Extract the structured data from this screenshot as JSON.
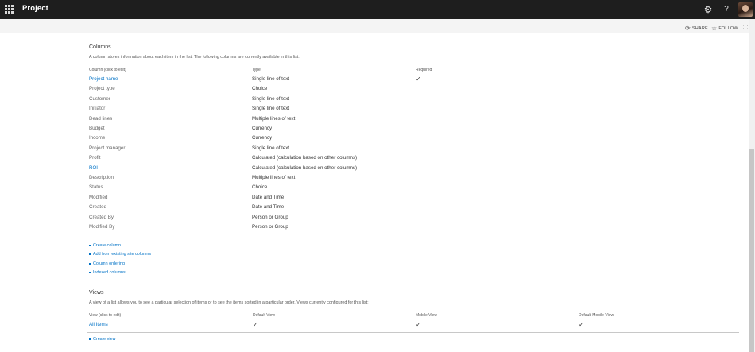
{
  "suite": {
    "app_title": "Project",
    "icons": [
      "waffle-icon",
      "gear-icon",
      "help-icon",
      "avatar"
    ]
  },
  "actions": {
    "share_label": "SHARE",
    "follow_label": "FOLLOW"
  },
  "columns_section": {
    "title": "Columns",
    "description": "A column stores information about each item in the list. The following columns are currently available in this list:",
    "headers": {
      "column": "Column (click to edit)",
      "type": "Type",
      "required": "Required"
    },
    "rows": [
      {
        "name": "Project name",
        "type": "Single line of text",
        "required": true,
        "link": true
      },
      {
        "name": "Project type",
        "type": "Choice",
        "required": false,
        "link": false
      },
      {
        "name": "Customer",
        "type": "Single line of text",
        "required": false,
        "link": false
      },
      {
        "name": "Initiator",
        "type": "Single line of text",
        "required": false,
        "link": false
      },
      {
        "name": "Dead lines",
        "type": "Multiple lines of text",
        "required": false,
        "link": false
      },
      {
        "name": "Budget",
        "type": "Currency",
        "required": false,
        "link": false
      },
      {
        "name": "Income",
        "type": "Currency",
        "required": false,
        "link": false
      },
      {
        "name": "Project manager",
        "type": "Single line of text",
        "required": false,
        "link": false
      },
      {
        "name": "Profit",
        "type": "Calculated (calculation based on other columns)",
        "required": false,
        "link": false
      },
      {
        "name": "ROI",
        "type": "Calculated (calculation based on other columns)",
        "required": false,
        "link": true
      },
      {
        "name": "Description",
        "type": "Multiple lines of text",
        "required": false,
        "link": false
      },
      {
        "name": "Status",
        "type": "Choice",
        "required": false,
        "link": false
      },
      {
        "name": "Modified",
        "type": "Date and Time",
        "required": false,
        "link": false
      },
      {
        "name": "Created",
        "type": "Date and Time",
        "required": false,
        "link": false
      },
      {
        "name": "Created By",
        "type": "Person or Group",
        "required": false,
        "link": false
      },
      {
        "name": "Modified By",
        "type": "Person or Group",
        "required": false,
        "link": false
      }
    ],
    "links": [
      "Create column",
      "Add from existing site columns",
      "Column ordering",
      "Indexed columns"
    ]
  },
  "views_section": {
    "title": "Views",
    "description": "A view of a list allows you to see a particular selection of items or to see the items sorted in a particular order. Views currently configured for this list:",
    "headers": {
      "view": "View (click to edit)",
      "default_view": "Default View",
      "mobile_view": "Mobile View",
      "default_mobile_view": "Default Mobile View"
    },
    "rows": [
      {
        "name": "All Items",
        "default_view": true,
        "mobile_view": true,
        "default_mobile_view": true
      }
    ],
    "links": [
      "Create view"
    ]
  },
  "colors": {
    "suitebar": "#1e1e1e",
    "link": "#0072c6",
    "text": "#333333"
  }
}
